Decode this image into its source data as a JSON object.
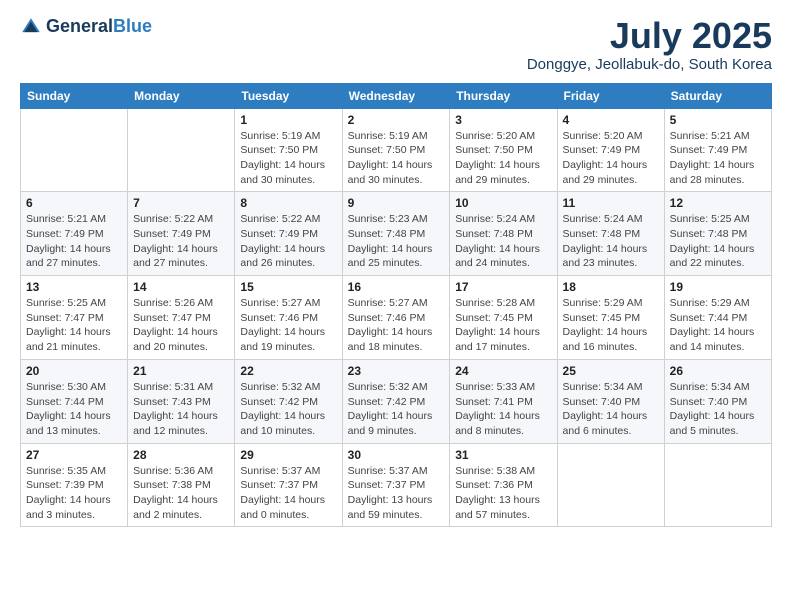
{
  "header": {
    "logo": {
      "text_general": "General",
      "text_blue": "Blue"
    },
    "title": "July 2025",
    "subtitle": "Donggye, Jeollabuk-do, South Korea"
  },
  "calendar": {
    "headers": [
      "Sunday",
      "Monday",
      "Tuesday",
      "Wednesday",
      "Thursday",
      "Friday",
      "Saturday"
    ],
    "weeks": [
      [
        {
          "day": "",
          "sunrise": "",
          "sunset": "",
          "daylight": ""
        },
        {
          "day": "",
          "sunrise": "",
          "sunset": "",
          "daylight": ""
        },
        {
          "day": "1",
          "sunrise": "Sunrise: 5:19 AM",
          "sunset": "Sunset: 7:50 PM",
          "daylight": "Daylight: 14 hours and 30 minutes."
        },
        {
          "day": "2",
          "sunrise": "Sunrise: 5:19 AM",
          "sunset": "Sunset: 7:50 PM",
          "daylight": "Daylight: 14 hours and 30 minutes."
        },
        {
          "day": "3",
          "sunrise": "Sunrise: 5:20 AM",
          "sunset": "Sunset: 7:50 PM",
          "daylight": "Daylight: 14 hours and 29 minutes."
        },
        {
          "day": "4",
          "sunrise": "Sunrise: 5:20 AM",
          "sunset": "Sunset: 7:49 PM",
          "daylight": "Daylight: 14 hours and 29 minutes."
        },
        {
          "day": "5",
          "sunrise": "Sunrise: 5:21 AM",
          "sunset": "Sunset: 7:49 PM",
          "daylight": "Daylight: 14 hours and 28 minutes."
        }
      ],
      [
        {
          "day": "6",
          "sunrise": "Sunrise: 5:21 AM",
          "sunset": "Sunset: 7:49 PM",
          "daylight": "Daylight: 14 hours and 27 minutes."
        },
        {
          "day": "7",
          "sunrise": "Sunrise: 5:22 AM",
          "sunset": "Sunset: 7:49 PM",
          "daylight": "Daylight: 14 hours and 27 minutes."
        },
        {
          "day": "8",
          "sunrise": "Sunrise: 5:22 AM",
          "sunset": "Sunset: 7:49 PM",
          "daylight": "Daylight: 14 hours and 26 minutes."
        },
        {
          "day": "9",
          "sunrise": "Sunrise: 5:23 AM",
          "sunset": "Sunset: 7:48 PM",
          "daylight": "Daylight: 14 hours and 25 minutes."
        },
        {
          "day": "10",
          "sunrise": "Sunrise: 5:24 AM",
          "sunset": "Sunset: 7:48 PM",
          "daylight": "Daylight: 14 hours and 24 minutes."
        },
        {
          "day": "11",
          "sunrise": "Sunrise: 5:24 AM",
          "sunset": "Sunset: 7:48 PM",
          "daylight": "Daylight: 14 hours and 23 minutes."
        },
        {
          "day": "12",
          "sunrise": "Sunrise: 5:25 AM",
          "sunset": "Sunset: 7:48 PM",
          "daylight": "Daylight: 14 hours and 22 minutes."
        }
      ],
      [
        {
          "day": "13",
          "sunrise": "Sunrise: 5:25 AM",
          "sunset": "Sunset: 7:47 PM",
          "daylight": "Daylight: 14 hours and 21 minutes."
        },
        {
          "day": "14",
          "sunrise": "Sunrise: 5:26 AM",
          "sunset": "Sunset: 7:47 PM",
          "daylight": "Daylight: 14 hours and 20 minutes."
        },
        {
          "day": "15",
          "sunrise": "Sunrise: 5:27 AM",
          "sunset": "Sunset: 7:46 PM",
          "daylight": "Daylight: 14 hours and 19 minutes."
        },
        {
          "day": "16",
          "sunrise": "Sunrise: 5:27 AM",
          "sunset": "Sunset: 7:46 PM",
          "daylight": "Daylight: 14 hours and 18 minutes."
        },
        {
          "day": "17",
          "sunrise": "Sunrise: 5:28 AM",
          "sunset": "Sunset: 7:45 PM",
          "daylight": "Daylight: 14 hours and 17 minutes."
        },
        {
          "day": "18",
          "sunrise": "Sunrise: 5:29 AM",
          "sunset": "Sunset: 7:45 PM",
          "daylight": "Daylight: 14 hours and 16 minutes."
        },
        {
          "day": "19",
          "sunrise": "Sunrise: 5:29 AM",
          "sunset": "Sunset: 7:44 PM",
          "daylight": "Daylight: 14 hours and 14 minutes."
        }
      ],
      [
        {
          "day": "20",
          "sunrise": "Sunrise: 5:30 AM",
          "sunset": "Sunset: 7:44 PM",
          "daylight": "Daylight: 14 hours and 13 minutes."
        },
        {
          "day": "21",
          "sunrise": "Sunrise: 5:31 AM",
          "sunset": "Sunset: 7:43 PM",
          "daylight": "Daylight: 14 hours and 12 minutes."
        },
        {
          "day": "22",
          "sunrise": "Sunrise: 5:32 AM",
          "sunset": "Sunset: 7:42 PM",
          "daylight": "Daylight: 14 hours and 10 minutes."
        },
        {
          "day": "23",
          "sunrise": "Sunrise: 5:32 AM",
          "sunset": "Sunset: 7:42 PM",
          "daylight": "Daylight: 14 hours and 9 minutes."
        },
        {
          "day": "24",
          "sunrise": "Sunrise: 5:33 AM",
          "sunset": "Sunset: 7:41 PM",
          "daylight": "Daylight: 14 hours and 8 minutes."
        },
        {
          "day": "25",
          "sunrise": "Sunrise: 5:34 AM",
          "sunset": "Sunset: 7:40 PM",
          "daylight": "Daylight: 14 hours and 6 minutes."
        },
        {
          "day": "26",
          "sunrise": "Sunrise: 5:34 AM",
          "sunset": "Sunset: 7:40 PM",
          "daylight": "Daylight: 14 hours and 5 minutes."
        }
      ],
      [
        {
          "day": "27",
          "sunrise": "Sunrise: 5:35 AM",
          "sunset": "Sunset: 7:39 PM",
          "daylight": "Daylight: 14 hours and 3 minutes."
        },
        {
          "day": "28",
          "sunrise": "Sunrise: 5:36 AM",
          "sunset": "Sunset: 7:38 PM",
          "daylight": "Daylight: 14 hours and 2 minutes."
        },
        {
          "day": "29",
          "sunrise": "Sunrise: 5:37 AM",
          "sunset": "Sunset: 7:37 PM",
          "daylight": "Daylight: 14 hours and 0 minutes."
        },
        {
          "day": "30",
          "sunrise": "Sunrise: 5:37 AM",
          "sunset": "Sunset: 7:37 PM",
          "daylight": "Daylight: 13 hours and 59 minutes."
        },
        {
          "day": "31",
          "sunrise": "Sunrise: 5:38 AM",
          "sunset": "Sunset: 7:36 PM",
          "daylight": "Daylight: 13 hours and 57 minutes."
        },
        {
          "day": "",
          "sunrise": "",
          "sunset": "",
          "daylight": ""
        },
        {
          "day": "",
          "sunrise": "",
          "sunset": "",
          "daylight": ""
        }
      ]
    ]
  }
}
